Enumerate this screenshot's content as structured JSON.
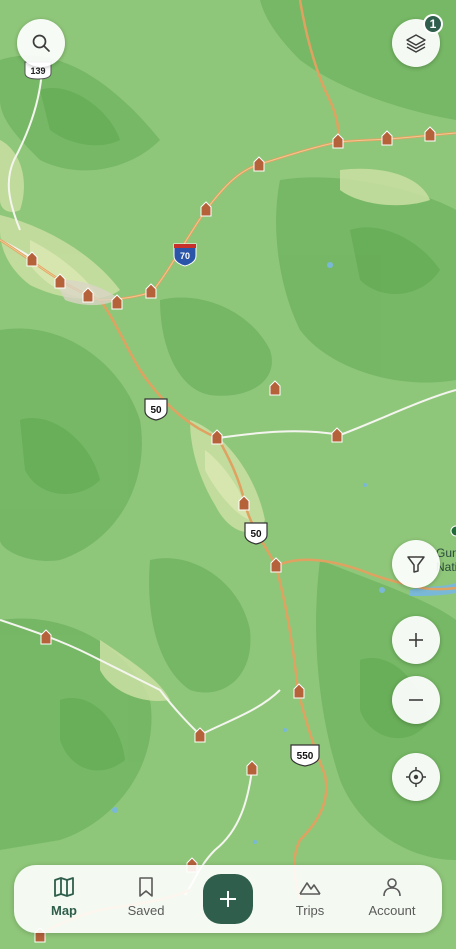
{
  "map": {
    "highway_shields": [
      {
        "label": "139",
        "type": "state"
      },
      {
        "label": "70",
        "type": "interstate"
      },
      {
        "label": "50",
        "type": "us"
      },
      {
        "label": "50",
        "type": "us"
      },
      {
        "label": "550",
        "type": "us"
      }
    ],
    "place_label_partial": [
      "Gun",
      "Nationa"
    ],
    "colors": {
      "land": "#8fc77a",
      "forest": "#6fb45f",
      "valley": "#c9dfa2",
      "road": "#e2a05c",
      "minor_road": "#f4f4f0",
      "campsite_pin": "#b5623b",
      "brand": "#2f5e4c"
    }
  },
  "controls": {
    "search_icon": "search-icon",
    "layers_icon": "layers-icon",
    "layers_badge": "1",
    "filter_icon": "filter-icon",
    "zoom_in_icon": "plus-icon",
    "zoom_out_icon": "minus-icon",
    "locate_icon": "crosshair-icon"
  },
  "navbar": {
    "items": [
      {
        "label": "Map",
        "icon": "map-icon",
        "active": true
      },
      {
        "label": "Saved",
        "icon": "bookmark-icon",
        "active": false
      },
      {
        "label": "Trips",
        "icon": "mountain-icon",
        "active": false
      },
      {
        "label": "Account",
        "icon": "person-icon",
        "active": false
      }
    ],
    "add_icon": "plus-icon"
  }
}
